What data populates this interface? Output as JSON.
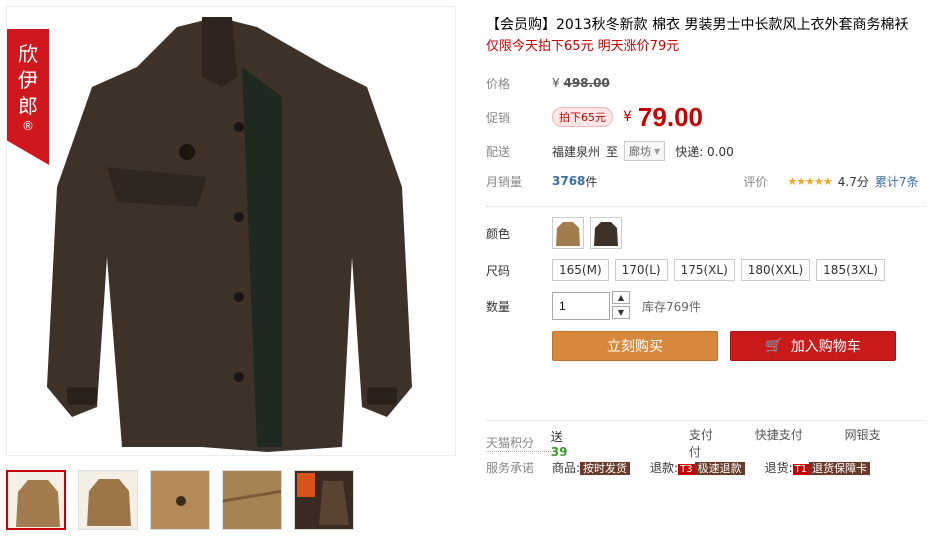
{
  "brand_tag": {
    "line1": "欣",
    "line2": "伊",
    "line3": "郎",
    "mark": "®"
  },
  "title": "【会员购】2013秋冬新款 棉衣 男装男士中长款风上衣外套商务棉袄",
  "promo": "仅限今天拍下65元 明天涨价79元",
  "price": {
    "label": "价格",
    "currency": "¥",
    "value": "498.00"
  },
  "promo_price": {
    "label": "促销",
    "badge": "拍下65元",
    "currency": "¥",
    "value": "79.00"
  },
  "shipping": {
    "label": "配送",
    "from": "福建泉州",
    "to_word": "至",
    "dest": "廊坊",
    "fee": "快递: 0.00"
  },
  "sales": {
    "label": "月销量",
    "value": "3768",
    "unit": "件",
    "rating_label": "评价",
    "stars": "★★★★★",
    "rating": "4.7分",
    "reviews": "累计7条"
  },
  "color": {
    "label": "颜色"
  },
  "size": {
    "label": "尺码",
    "options": [
      "165(M)",
      "170(L)",
      "175(XL)",
      "180(XXL)",
      "185(3XL)"
    ]
  },
  "qty": {
    "label": "数量",
    "value": "1",
    "up": "▲",
    "down": "▼",
    "stock": "库存769件"
  },
  "buttons": {
    "buy": "立刻购买",
    "cart": "加入购物车",
    "cart_icon": "🛒"
  },
  "points": {
    "label": "天猫积分",
    "prefix": "送",
    "value": "39"
  },
  "payments": [
    "支付",
    "快捷支付",
    "网银支付"
  ],
  "service": {
    "label": "服务承诺",
    "items": [
      {
        "prefix": "商品:",
        "tag": "按时发货"
      },
      {
        "prefix": "退款:",
        "t": "T3",
        "tag": "极速退款"
      },
      {
        "prefix": "退货:",
        "t": "T1",
        "tag": "退货保障卡"
      }
    ]
  },
  "colors": {
    "accent": "#c40000",
    "buy": "#d8883c",
    "cart": "#c9191b",
    "jacket": "#3d3128"
  }
}
